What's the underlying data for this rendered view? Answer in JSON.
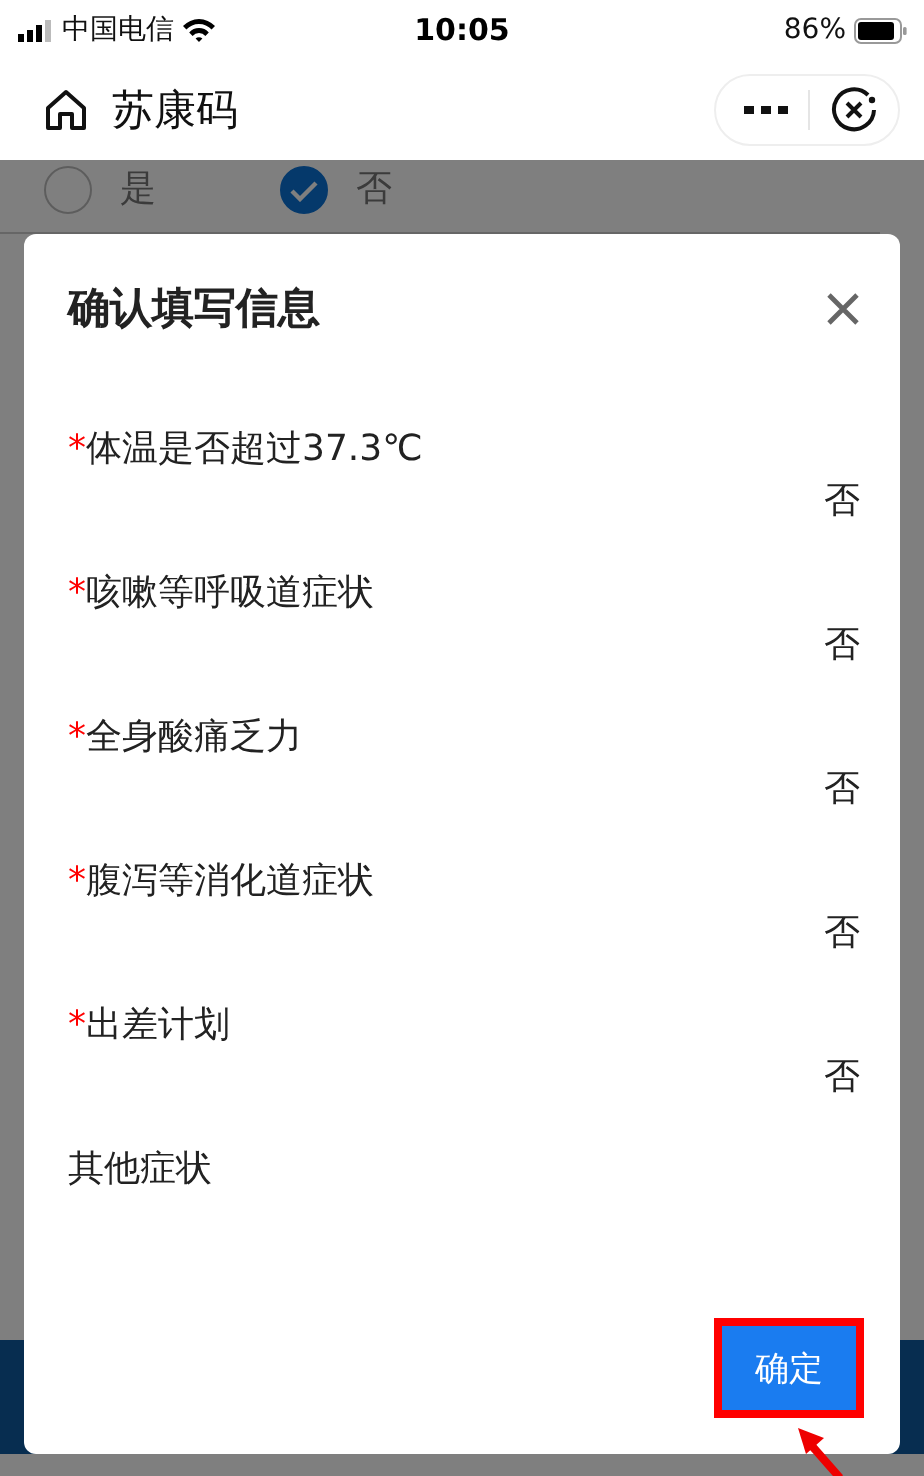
{
  "status_bar": {
    "carrier": "中国电信",
    "time": "10:05",
    "battery": "86%"
  },
  "nav": {
    "title": "苏康码"
  },
  "background_form": {
    "options": [
      {
        "label": "是",
        "selected": false
      },
      {
        "label": "否",
        "selected": true
      }
    ]
  },
  "dialog": {
    "title": "确认填写信息",
    "fields": [
      {
        "required_mark": "*",
        "label": "体温是否超过37.3℃",
        "answer": "否"
      },
      {
        "required_mark": "*",
        "label": "咳嗽等呼吸道症状",
        "answer": "否"
      },
      {
        "required_mark": "*",
        "label": "全身酸痛乏力",
        "answer": "否"
      },
      {
        "required_mark": "*",
        "label": "腹泻等消化道症状",
        "answer": "否"
      },
      {
        "required_mark": "*",
        "label": "出差计划",
        "answer": "否"
      },
      {
        "label": "其他症状"
      }
    ],
    "confirm_button": {
      "label": "确定",
      "highlighted": true
    }
  }
}
